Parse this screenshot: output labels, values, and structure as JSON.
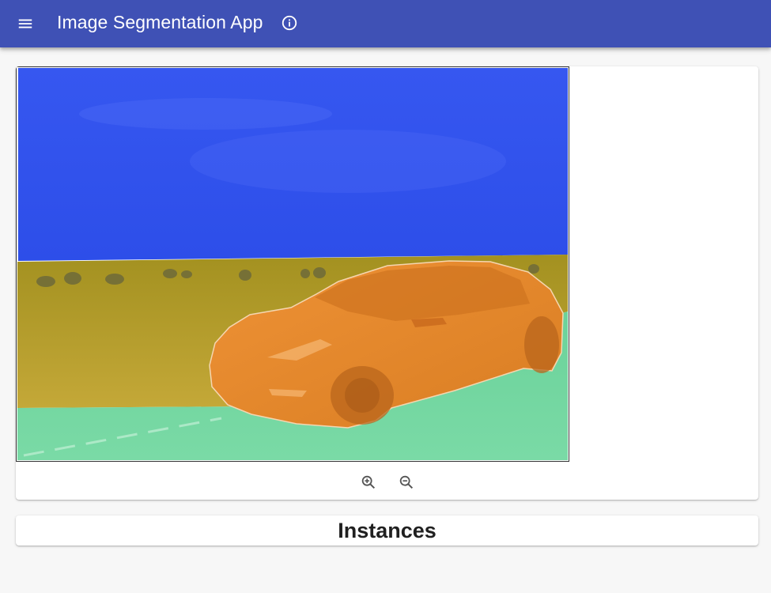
{
  "app": {
    "title": "Image Segmentation App",
    "icons": {
      "menu": "menu-icon",
      "info": "info-icon"
    },
    "accent_color": "#3f51b5"
  },
  "viewer": {
    "segments": [
      {
        "region": "sky",
        "color": "#3d5cf6"
      },
      {
        "region": "grass",
        "color": "#b59e1a"
      },
      {
        "region": "road",
        "color": "#6dd49a"
      },
      {
        "region": "car",
        "color": "#e68a2e"
      }
    ],
    "zoom_controls": [
      {
        "name": "zoom-in",
        "icon": "zoom-in-icon"
      },
      {
        "name": "zoom-out",
        "icon": "zoom-out-icon"
      }
    ]
  },
  "instances": {
    "heading": "Instances"
  }
}
